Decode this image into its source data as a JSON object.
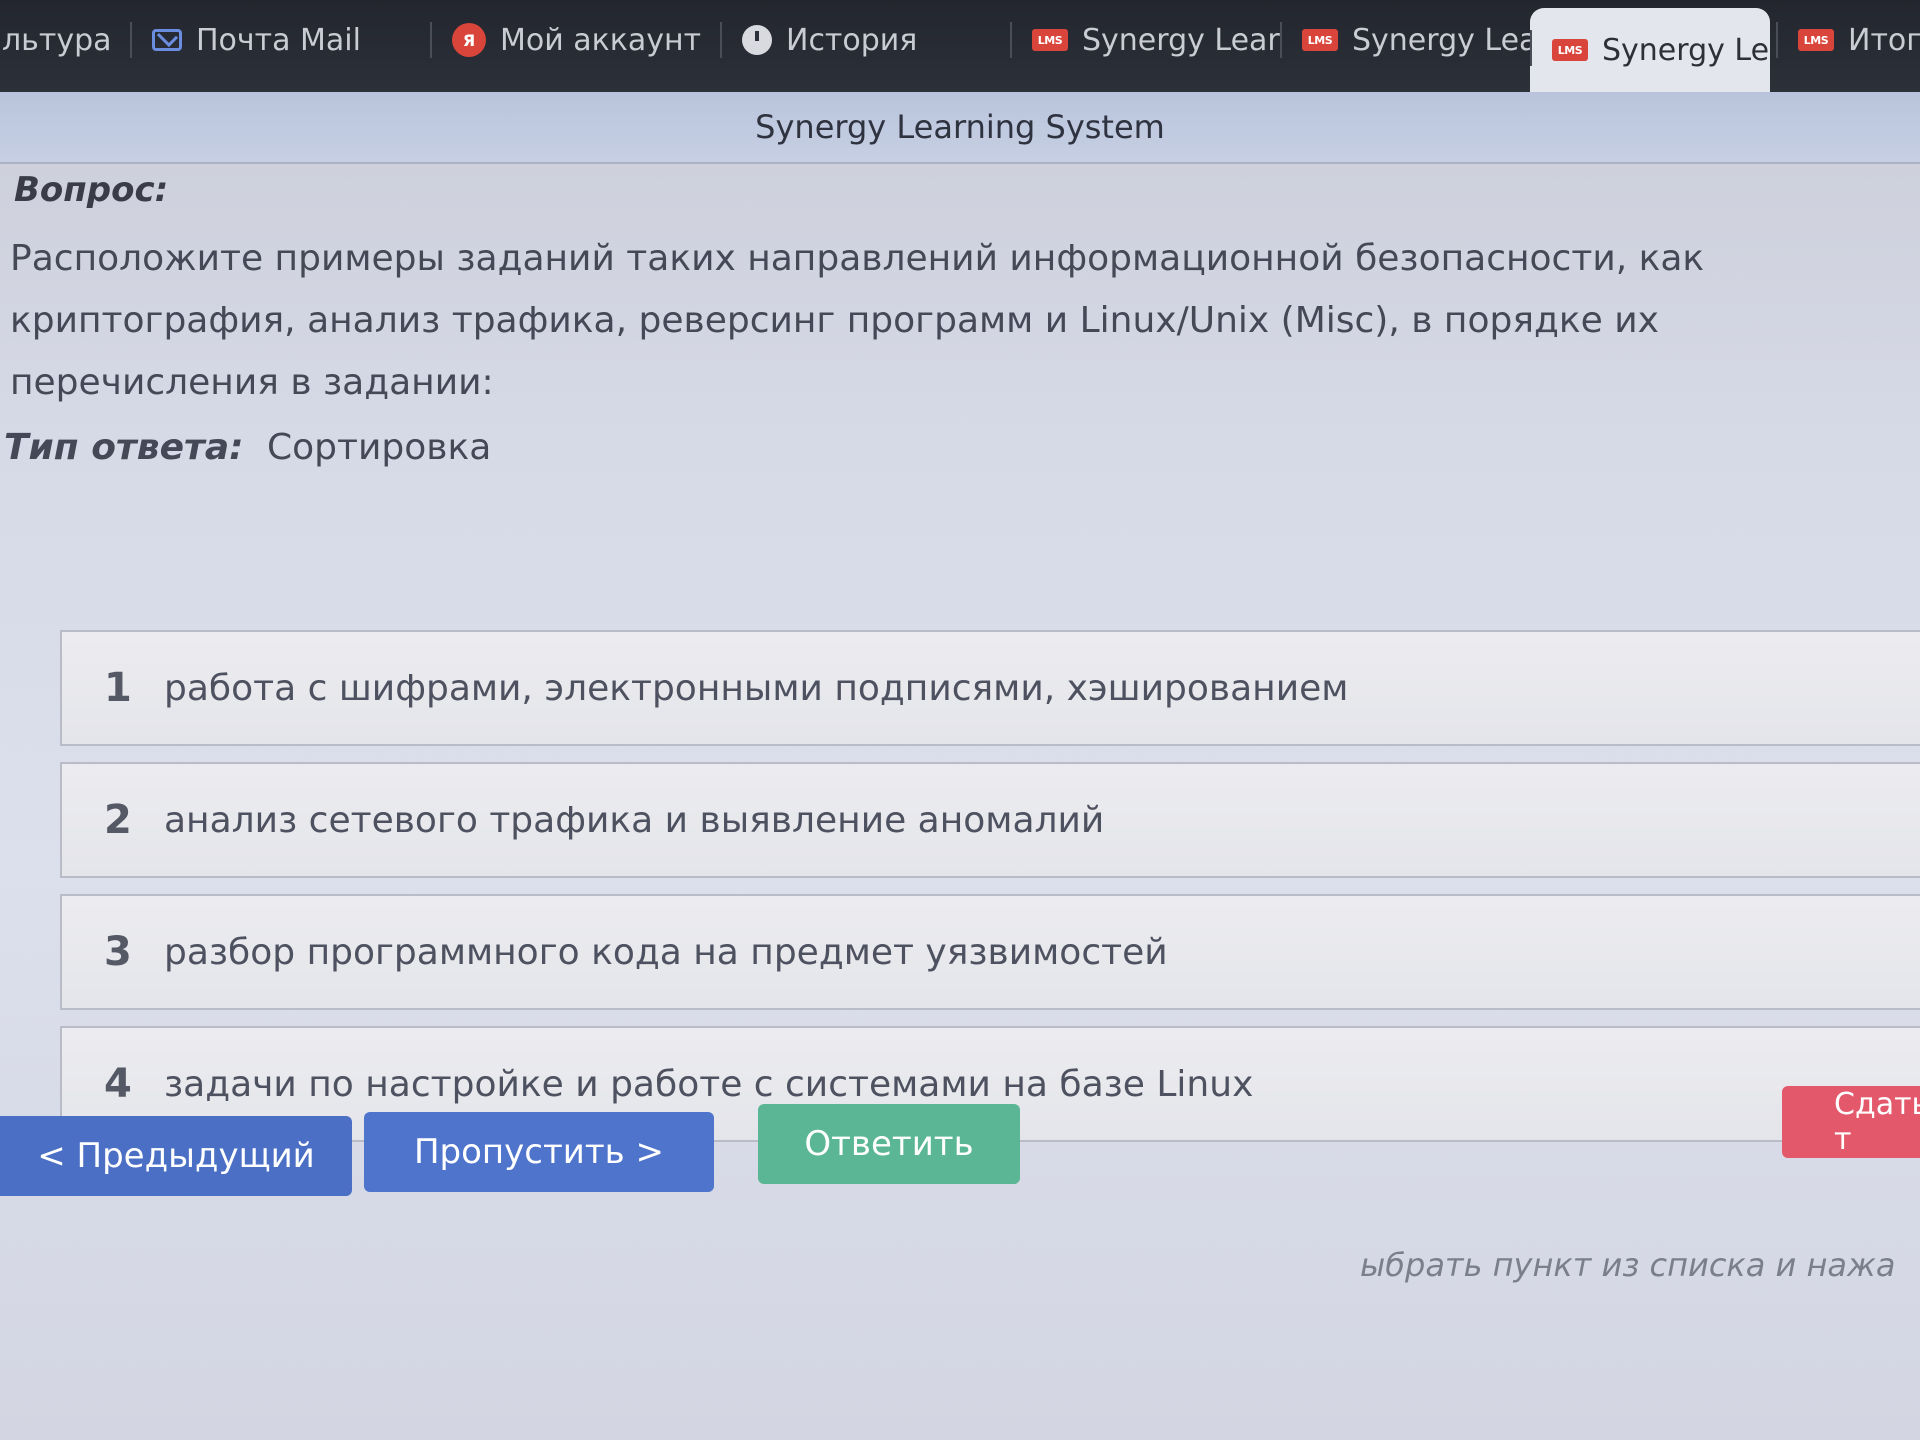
{
  "browser": {
    "tabs": [
      {
        "label": "льтура",
        "icon": "none"
      },
      {
        "label": "Почта Mail",
        "icon": "mail-icon"
      },
      {
        "label": "Мой аккаунт",
        "icon": "account-icon"
      },
      {
        "label": "История",
        "icon": "history-icon"
      },
      {
        "label": "Synergy Learn",
        "icon": "synergy-icon"
      },
      {
        "label": "Synergy Learn",
        "icon": "synergy-icon"
      },
      {
        "label": "Synergy Le",
        "icon": "synergy-icon",
        "active": true
      },
      {
        "label": "Итогов",
        "icon": "synergy-icon"
      }
    ],
    "account_icon_text": "Я",
    "synergy_icon_text": "LMS",
    "close_glyph": "✕"
  },
  "page": {
    "title": "Synergy Learning System",
    "question_label": "Вопрос:",
    "question_text": "Расположите примеры заданий таких направлений информационной безопасности, как криптография, анализ трафика, реверсинг программ и Linux/Unix (Misc), в порядке их перечисления в задании:",
    "answer_type_label": "Тип ответа:",
    "answer_type_value": "Сортировка"
  },
  "sort_items": [
    {
      "num": "1",
      "text": "работа с шифрами, электронными подписями, хэшированием"
    },
    {
      "num": "2",
      "text": "анализ сетевого трафика и выявление аномалий"
    },
    {
      "num": "3",
      "text": "разбор программного кода на предмет уязвимостей"
    },
    {
      "num": "4",
      "text": "задачи по настройке и работе с системами на базе Linux"
    }
  ],
  "buttons": {
    "prev": "< Предыдущий",
    "skip": "Пропустить >",
    "answer": "Ответить",
    "submit": "Сдать т"
  },
  "hint": "ыбрать пункт из списка и нажа",
  "colors": {
    "primary_button": "#4e74cc",
    "answer_button": "#5ab694",
    "submit_button": "#e4586c",
    "synergy_brand": "#d9453a"
  }
}
